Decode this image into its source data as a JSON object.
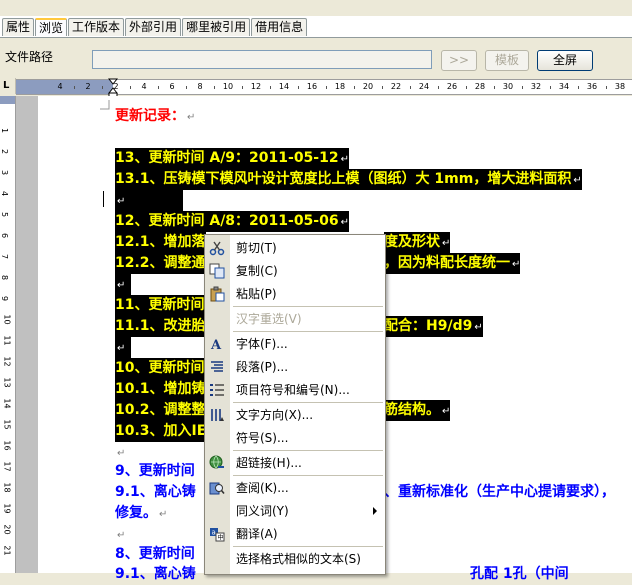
{
  "tabs": [
    {
      "label": "属性",
      "active": false
    },
    {
      "label": "浏览",
      "active": true
    },
    {
      "label": "工作版本",
      "active": false
    },
    {
      "label": "外部引用",
      "active": false
    },
    {
      "label": "哪里被引用",
      "active": false
    },
    {
      "label": "借用信息",
      "active": false
    }
  ],
  "pathbar": {
    "label": "文件路径",
    "value": "",
    "go_label": ">>",
    "template_label": "模板",
    "fullscreen_label": "全屏"
  },
  "ruler": {
    "corner": "L",
    "ticks": [
      "4",
      "2",
      "2",
      "4",
      "6",
      "8",
      "10",
      "12",
      "14",
      "16",
      "18",
      "20",
      "22",
      "24",
      "26",
      "28",
      "30",
      "32",
      "34",
      "36",
      "38"
    ],
    "vticks": [
      "1",
      "2",
      "3",
      "4",
      "5",
      "6",
      "7",
      "8",
      "9",
      "10",
      "11",
      "12",
      "13",
      "14",
      "15",
      "16",
      "17",
      "18",
      "19",
      "20",
      "21",
      "22"
    ]
  },
  "document": {
    "heading": "更新记录：",
    "lines": [
      {
        "text": "13、更新时间 A/9：2011-05-12"
      },
      {
        "text": "13.1、压铸模下模风叶设计宽度比上模（图纸）大 1mm，增大进料面积"
      },
      {
        "text": ""
      },
      {
        "text": "12、更新时间 A/8：2011-05-06"
      },
      {
        "text": "12.1、增加落"
      },
      {
        "text": "度及形状"
      },
      {
        "text": "12.2、调整通"
      },
      {
        "text": "，因为料配长度统一"
      },
      {
        "text": ""
      },
      {
        "text": "11、更新时间"
      },
      {
        "text": "11.1、改进胎"
      },
      {
        "text": "配合：H9/d9"
      },
      {
        "text": ""
      },
      {
        "text": "10、更新时间"
      },
      {
        "text": "10.1、增加铸"
      },
      {
        "text": "10.2、调整整"
      },
      {
        "text": "筋结构。"
      },
      {
        "text": "10.3、加入IE"
      },
      {
        "text": ""
      },
      {
        "text": "9、更新时间"
      },
      {
        "text": "9.1、离心铸"
      },
      {
        "text": "、重新标准化（生产中心提请要求），"
      },
      {
        "text": "修复。"
      },
      {
        "text": ""
      },
      {
        "text": "8、更新时间"
      },
      {
        "text": "9.1、离心铸"
      },
      {
        "text": "孔配 1孔（中间"
      }
    ],
    "pilcrow": "↵"
  },
  "context_menu": {
    "items": [
      {
        "label": "剪切(T)",
        "icon": "scissors-icon",
        "disabled": false
      },
      {
        "label": "复制(C)",
        "icon": "copy-icon",
        "disabled": false
      },
      {
        "label": "粘贴(P)",
        "icon": "paste-icon",
        "disabled": false
      },
      {
        "label": "汉字重选(V)",
        "icon": "",
        "disabled": true
      },
      {
        "label": "字体(F)...",
        "icon": "font-icon",
        "disabled": false
      },
      {
        "label": "段落(P)...",
        "icon": "paragraph-icon",
        "disabled": false
      },
      {
        "label": "项目符号和编号(N)...",
        "icon": "bullets-icon",
        "disabled": false
      },
      {
        "label": "文字方向(X)...",
        "icon": "text-direction-icon",
        "disabled": false
      },
      {
        "label": "符号(S)...",
        "icon": "",
        "disabled": false
      },
      {
        "label": "超链接(H)...",
        "icon": "hyperlink-icon",
        "disabled": false
      },
      {
        "label": "查阅(K)...",
        "icon": "research-icon",
        "disabled": false
      },
      {
        "label": "同义词(Y)",
        "icon": "",
        "disabled": false,
        "submenu": true
      },
      {
        "label": "翻译(A)",
        "icon": "translate-icon",
        "disabled": false
      },
      {
        "label": "选择格式相似的文本(S)",
        "icon": "",
        "disabled": false
      }
    ]
  }
}
